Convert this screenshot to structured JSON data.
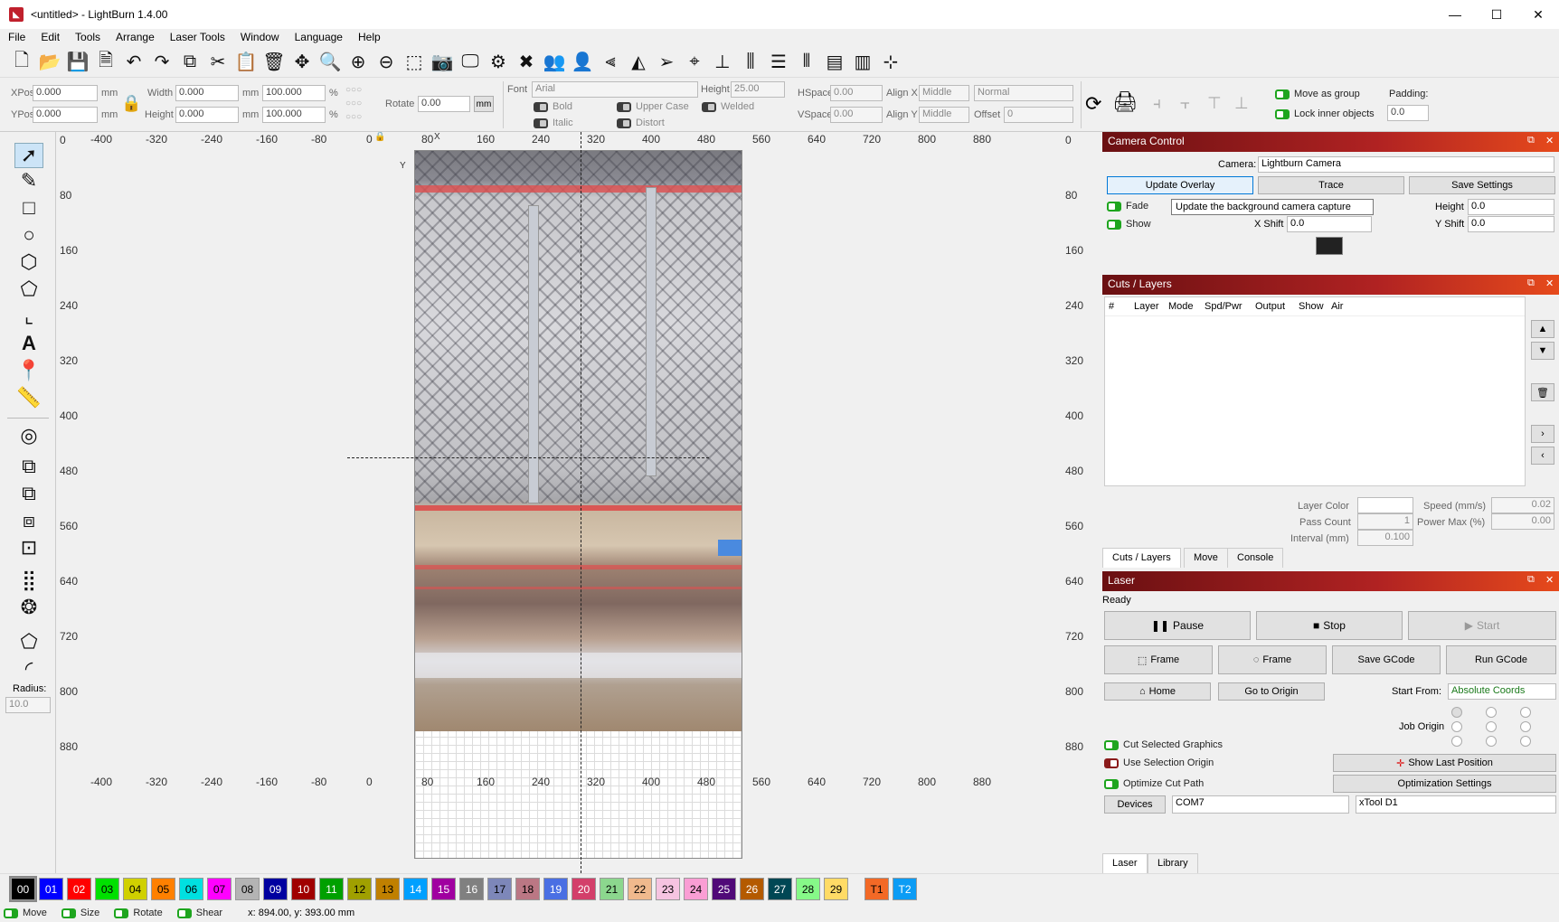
{
  "window": {
    "title": "<untitled> - LightBurn 1.4.00",
    "minimize": "—",
    "maximize": "☐",
    "close": "✕"
  },
  "menu": [
    "File",
    "Edit",
    "Tools",
    "Arrange",
    "Laser Tools",
    "Window",
    "Language",
    "Help"
  ],
  "toolbar_icons": [
    "new-file-icon",
    "open-file-icon",
    "save-icon",
    "save-as-icon",
    "undo-icon",
    "redo-icon",
    "copy-icon",
    "cut-icon",
    "paste-icon",
    "delete-icon",
    "move-icon",
    "zoom-selection-icon",
    "zoom-in-icon",
    "zoom-out-icon",
    "frame-selection-icon",
    "camera-capture-icon",
    "monitor-icon",
    "settings-icon",
    "tools-icon",
    "users-icon",
    "user-icon",
    "flip-vertical-icon",
    "mirror-icon",
    "send-icon",
    "target-icon",
    "align-icon",
    "distribute-icon",
    "align-h-icon",
    "align-v-icon",
    "group-icon",
    "ungroup-icon",
    "snap-icon"
  ],
  "numeric_edits": {
    "xpos_label": "XPos",
    "xpos": "0.000",
    "ypos_label": "YPos",
    "ypos": "0.000",
    "unit": "mm",
    "width_label": "Width",
    "width": "0.000",
    "height_label": "Height",
    "height": "0.000",
    "width_pct": "100.000",
    "height_pct": "100.000",
    "pct": "%",
    "rotate_label": "Rotate",
    "rotate": "0.00",
    "rotate_unit": "mm"
  },
  "text_options": {
    "font_label": "Font",
    "font": "Arial",
    "height_label": "Height",
    "height": "25.00",
    "bold": "Bold",
    "italic": "Italic",
    "upper_case": "Upper Case",
    "distort": "Distort",
    "welded": "Welded",
    "hspace_label": "HSpace",
    "hspace": "0.00",
    "vspace_label": "VSpace",
    "vspace": "0.00",
    "alignx_label": "Align X",
    "alignx": "Middle",
    "aligny_label": "Align Y",
    "aligny": "Middle",
    "style": "Normal",
    "offset_label": "Offset",
    "offset": "0"
  },
  "group_options": {
    "move_as_group": "Move as group",
    "lock_inner": "Lock inner objects",
    "padding_label": "Padding:",
    "padding": "0.0"
  },
  "left_tools": [
    "select-tool-icon",
    "pen-tool-icon",
    "rectangle-tool-icon",
    "ellipse-tool-icon",
    "polygon-tool-icon",
    "pentagon-tool-icon",
    "corner-tool-icon",
    "text-tool-icon",
    "position-tool-icon",
    "measure-tool-icon",
    "offset-icon",
    "weld-icon",
    "boolean-union-icon",
    "boolean-subtract-icon",
    "boolean-intersect-icon",
    "grid-array-icon",
    "circular-array-icon",
    "edit-nodes-icon",
    "corner-radius-icon"
  ],
  "radius": {
    "label": "Radius:",
    "value": "10.0"
  },
  "ruler": {
    "x_labels": [
      "-400",
      "-320",
      "-240",
      "-160",
      "-80",
      "0",
      "80",
      "160",
      "240",
      "320",
      "400",
      "480",
      "560",
      "640",
      "720",
      "800",
      "880"
    ],
    "y_labels": [
      "0",
      "80",
      "160",
      "240",
      "320",
      "400",
      "480",
      "560",
      "640",
      "720",
      "800",
      "880"
    ],
    "x_axis": "X",
    "y_axis": "Y"
  },
  "camera_control": {
    "title": "Camera Control",
    "camera_label": "Camera:",
    "camera": "Lightburn Camera",
    "update_overlay": "Update Overlay",
    "trace": "Trace",
    "save_settings": "Save Settings",
    "tooltip": "Update the background camera capture",
    "fade": "Fade",
    "show": "Show",
    "height_label": "Height",
    "height": "0.0",
    "xshift_label": "X Shift",
    "xshift": "0.0",
    "yshift_label": "Y Shift",
    "yshift": "0.0"
  },
  "cuts_layers": {
    "title": "Cuts / Layers",
    "columns": [
      "#",
      "Layer",
      "Mode",
      "Spd/Pwr",
      "Output",
      "Show",
      "Air"
    ],
    "layer_color_label": "Layer Color",
    "pass_count_label": "Pass Count",
    "pass_count": "1",
    "interval_label": "Interval (mm)",
    "interval": "0.100",
    "speed_label": "Speed (mm/s)",
    "speed": "0.02",
    "power_label": "Power Max (%)",
    "power": "0.00",
    "tabs": [
      "Cuts / Layers",
      "Move",
      "Console"
    ]
  },
  "laser": {
    "title": "Laser",
    "status": "Ready",
    "pause": "Pause",
    "stop": "Stop",
    "start": "Start",
    "frame1": "Frame",
    "frame2": "Frame",
    "save_gcode": "Save GCode",
    "run_gcode": "Run GCode",
    "home": "Home",
    "go_to_origin": "Go to Origin",
    "start_from_label": "Start From:",
    "start_from": "Absolute Coords",
    "job_origin": "Job Origin",
    "cut_selected": "Cut Selected Graphics",
    "use_selection_origin": "Use Selection Origin",
    "optimize": "Optimize Cut Path",
    "show_last_position": "Show Last Position",
    "optimization_settings": "Optimization Settings",
    "devices": "Devices",
    "port": "COM7",
    "device": "xTool D1",
    "tabs": [
      "Laser",
      "Library"
    ]
  },
  "palette": [
    {
      "label": "00",
      "color": "#000000",
      "text": "#ffffff"
    },
    {
      "label": "01",
      "color": "#0000ff",
      "text": "#ffffff"
    },
    {
      "label": "02",
      "color": "#ff0000",
      "text": "#ffffff"
    },
    {
      "label": "03",
      "color": "#00e000",
      "text": "#000000"
    },
    {
      "label": "04",
      "color": "#d0d000",
      "text": "#000000"
    },
    {
      "label": "05",
      "color": "#ff8000",
      "text": "#000000"
    },
    {
      "label": "06",
      "color": "#00e0e0",
      "text": "#000000"
    },
    {
      "label": "07",
      "color": "#ff00ff",
      "text": "#000000"
    },
    {
      "label": "08",
      "color": "#b4b4b4",
      "text": "#000000"
    },
    {
      "label": "09",
      "color": "#0000a0",
      "text": "#ffffff"
    },
    {
      "label": "10",
      "color": "#a00000",
      "text": "#ffffff"
    },
    {
      "label": "11",
      "color": "#00a000",
      "text": "#ffffff"
    },
    {
      "label": "12",
      "color": "#a0a000",
      "text": "#000000"
    },
    {
      "label": "13",
      "color": "#c08000",
      "text": "#000000"
    },
    {
      "label": "14",
      "color": "#00a0ff",
      "text": "#ffffff"
    },
    {
      "label": "15",
      "color": "#a000a0",
      "text": "#ffffff"
    },
    {
      "label": "16",
      "color": "#808080",
      "text": "#ffffff"
    },
    {
      "label": "17",
      "color": "#7d87b9",
      "text": "#000000"
    },
    {
      "label": "18",
      "color": "#bb7784",
      "text": "#000000"
    },
    {
      "label": "19",
      "color": "#4a6fe3",
      "text": "#ffffff"
    },
    {
      "label": "20",
      "color": "#d33f6a",
      "text": "#ffffff"
    },
    {
      "label": "21",
      "color": "#8cd78e",
      "text": "#000000"
    },
    {
      "label": "22",
      "color": "#f0b98d",
      "text": "#000000"
    },
    {
      "label": "23",
      "color": "#f6c4e1",
      "text": "#000000"
    },
    {
      "label": "24",
      "color": "#fa9ed4",
      "text": "#000000"
    },
    {
      "label": "25",
      "color": "#500a78",
      "text": "#ffffff"
    },
    {
      "label": "26",
      "color": "#b45a00",
      "text": "#ffffff"
    },
    {
      "label": "27",
      "color": "#004754",
      "text": "#ffffff"
    },
    {
      "label": "28",
      "color": "#86fa88",
      "text": "#000000"
    },
    {
      "label": "29",
      "color": "#ffdb66",
      "text": "#000000"
    },
    {
      "label": "T1",
      "color": "#f36926",
      "text": "#000000"
    },
    {
      "label": "T2",
      "color": "#0c9cf5",
      "text": "#ffffff"
    }
  ],
  "status_bar": {
    "move": "Move",
    "size": "Size",
    "rotate": "Rotate",
    "shear": "Shear",
    "coords": "x: 894.00, y: 393.00 mm"
  }
}
